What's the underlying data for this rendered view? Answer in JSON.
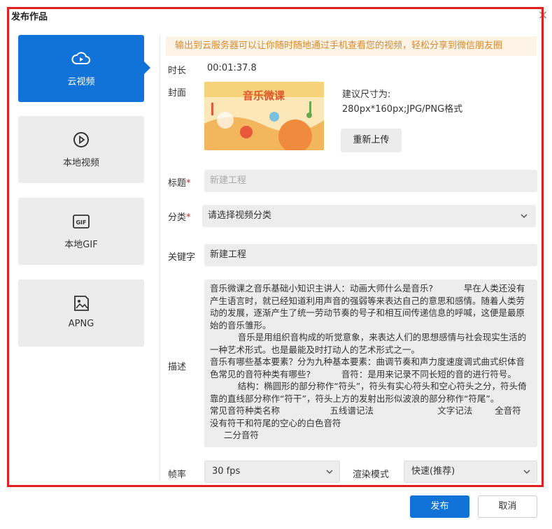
{
  "dialog": {
    "title": "发布作品",
    "close_glyph": "×"
  },
  "nav": {
    "items": [
      {
        "label": "云视频",
        "icon": "cloud-video-icon",
        "active": true
      },
      {
        "label": "本地视频",
        "icon": "play-circle-icon",
        "active": false
      },
      {
        "label": "本地GIF",
        "icon": "gif-icon",
        "active": false
      },
      {
        "label": "APNG",
        "icon": "image-file-icon",
        "active": false
      }
    ]
  },
  "banner": "输出到云服务器可以让你随时随地通过手机查看您的视频，轻松分享到微信朋友圈",
  "form": {
    "duration_label": "时长",
    "duration_value": "00:01:37.8",
    "cover_label": "封面",
    "cover_hint_line1": "建议尺寸为:",
    "cover_hint_line2": "280px*160px;JPG/PNG格式",
    "cover_thumb_text": "音乐微课",
    "reupload_label": "重新上传",
    "title_label": "标题",
    "title_placeholder": "新建工程",
    "category_label": "分类",
    "category_placeholder": "请选择视频分类",
    "keywords_label": "关键字",
    "keywords_value": "新建工程",
    "description_label": "描述",
    "description_value": "音乐微课之音乐基础小知识主讲人：动画大师什么是音乐?           早在人类还没有产生语言时，就已经知道利用声音的强弱等来表达自己的意思和感情。随着人类劳动的发展，逐渐产生了统一劳动节奏的号子和相互间传递信息的呼喊，这便是最原始的音乐雏形。\n          音乐是用组织音构成的听觉意象，来表达人们的思想感情与社会现实生活的一种艺术形式。也是最能及时打动人的艺术形式之一。\n音乐有哪些基本要素？分为九种基本要素：曲调节奏和声力度速度调式曲式织体音色常见的音符种类有哪些?           音符：是用来记录不同长短的音的进行符号。\n          结构：椭圆形的部分称作“符头”，符头有实心符头和空心符头之分，符头倚靠的直线部分称作“符干”，符头上方的发射出形似波浪的部分称作“符尾”。\n常见音符种类名称                  五线谱记法                       文字记法        全音符\n没有符干和符尾的空心的白色音符\n     二分音符",
    "fps_label": "帧率",
    "fps_value": "30 fps",
    "render_label": "渲染模式",
    "render_value": "快速(推荐)",
    "required_mark": "*"
  },
  "footer": {
    "publish_label": "发布",
    "cancel_label": "取消"
  },
  "colors": {
    "accent": "#1173d8",
    "highlight_frame": "#e02020",
    "banner_text": "#d98a2b",
    "banner_bg": "#fdf3e6"
  }
}
